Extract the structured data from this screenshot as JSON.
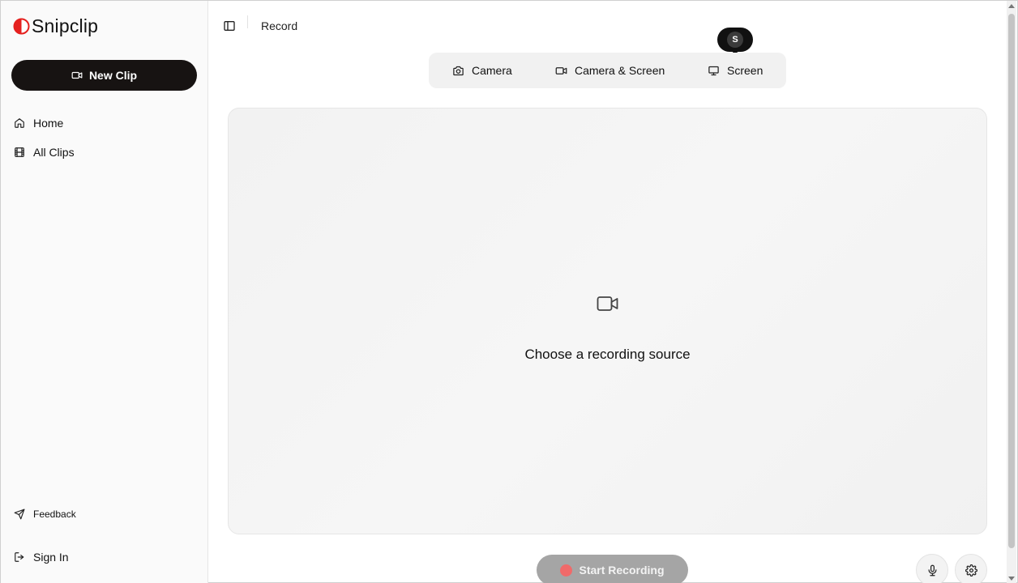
{
  "app": {
    "name": "Snipclip"
  },
  "sidebar": {
    "new_clip_label": "New Clip",
    "items": [
      {
        "label": "Home",
        "icon": "home-icon"
      },
      {
        "label": "All Clips",
        "icon": "film-icon"
      }
    ],
    "footer": [
      {
        "label": "Feedback",
        "icon": "send-icon"
      },
      {
        "label": "Sign In",
        "icon": "log-in-icon"
      }
    ]
  },
  "header": {
    "breadcrumb": "Record"
  },
  "tooltip": {
    "avatar_initial": "S"
  },
  "source_tabs": [
    {
      "label": "Camera",
      "icon": "camera-icon"
    },
    {
      "label": "Camera & Screen",
      "icon": "video-icon"
    },
    {
      "label": "Screen",
      "icon": "monitor-icon"
    }
  ],
  "stage": {
    "message": "Choose a recording source",
    "icon": "video-icon"
  },
  "controls": {
    "start_label": "Start Recording",
    "mic_icon": "mic-icon",
    "settings_icon": "gear-icon"
  },
  "colors": {
    "brand_red": "#e5211f",
    "primary_button": "#171312",
    "disabled_button": "#a5a5a5",
    "record_dot": "#f06a6a"
  }
}
